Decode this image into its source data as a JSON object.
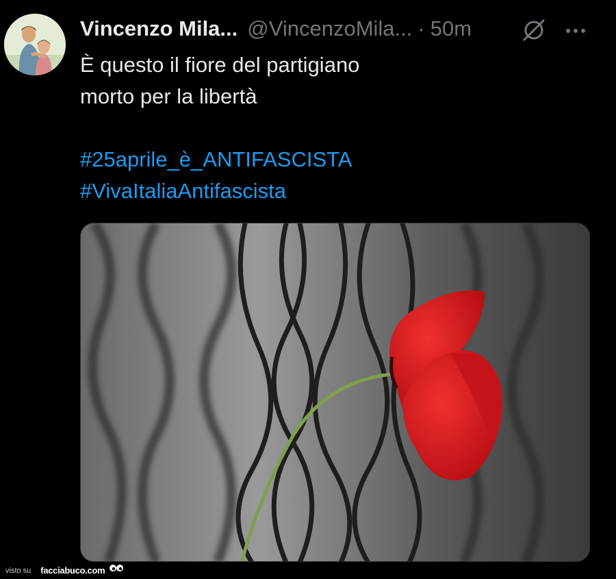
{
  "tweet": {
    "author_name": "Vincenzo Mila...",
    "author_handle": "@VincenzoMila...",
    "separator": "·",
    "timestamp": "50m",
    "text_lines": [
      "È questo il fiore del partigiano",
      "morto per la libertà"
    ],
    "hashtags": [
      "#25aprile_è_ANTIFASCISTA",
      "#VivaItaliaAntifascista"
    ],
    "icons": {
      "grok": "grok-icon",
      "more": "more-options-icon",
      "avatar": "avatar"
    },
    "colors": {
      "hashtag": "#1d9bf0",
      "text": "#e7e9ea",
      "secondary": "#71767b",
      "background": "#000000",
      "flower": "#d31a1a",
      "stem": "#7ea04a"
    }
  },
  "footer": {
    "visto_label": "visto su",
    "site_label": "facciabuco.com"
  }
}
